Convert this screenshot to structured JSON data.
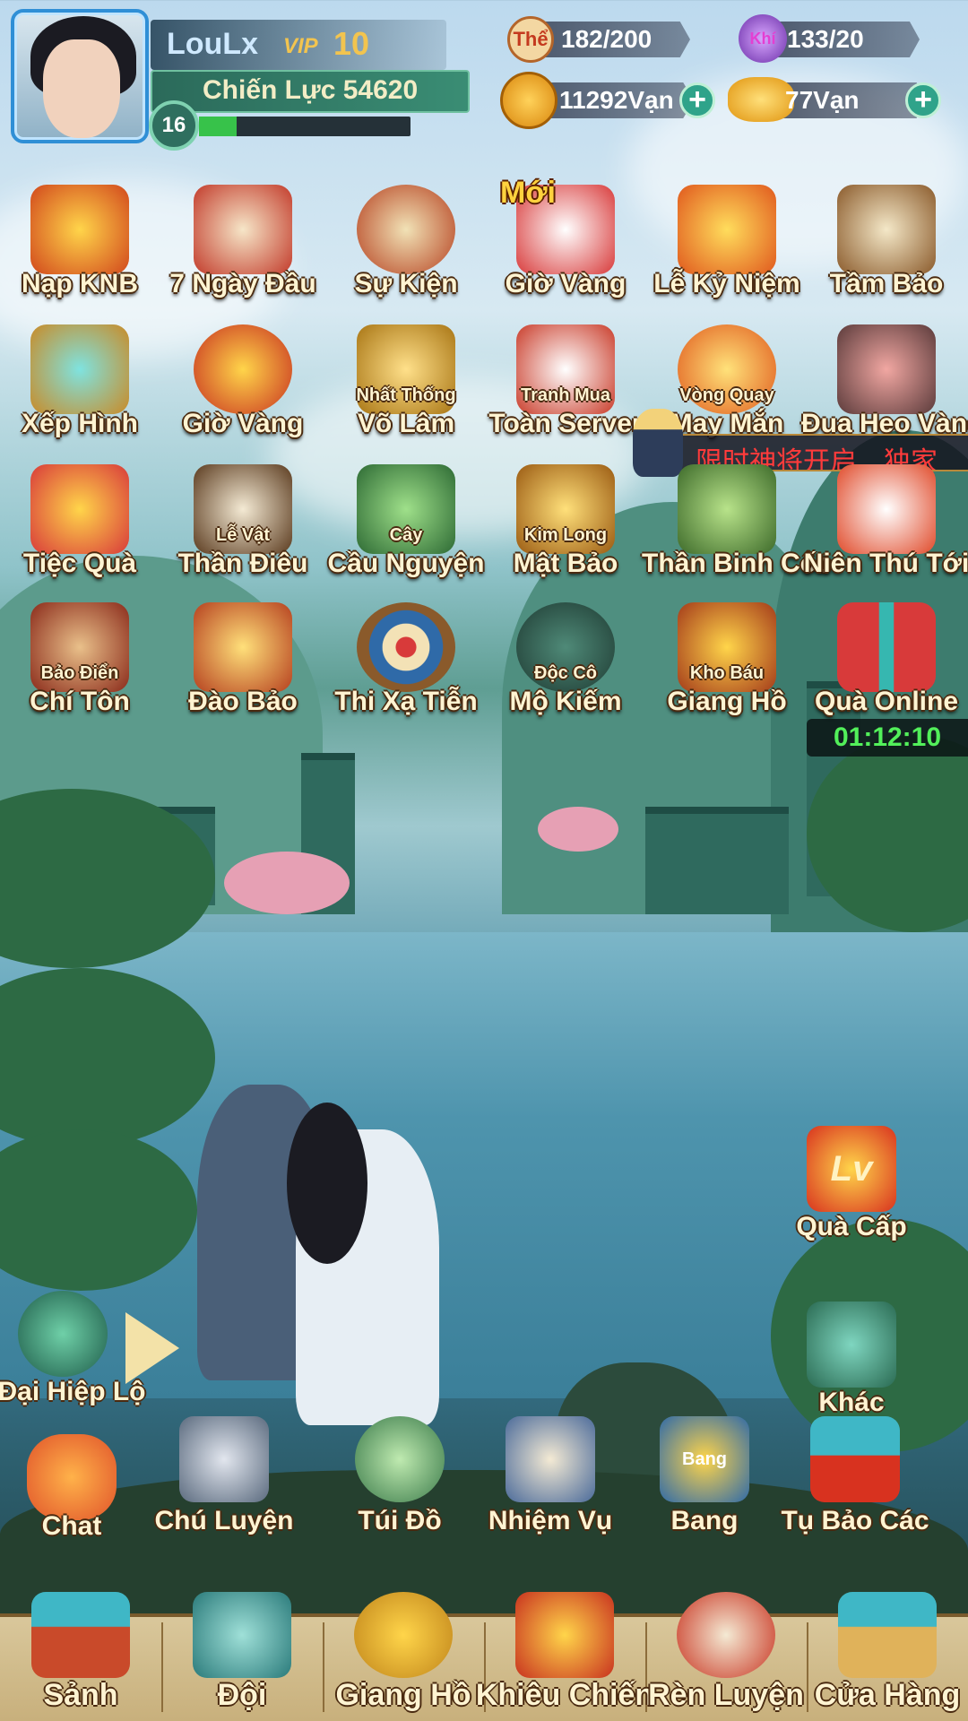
{
  "player": {
    "name": "LouLx",
    "vip_label": "VIP",
    "vip_level": "10",
    "power": "Chiến Lực 54620",
    "level": "16",
    "exp_fraction": 0.18
  },
  "resources": {
    "stamina_icon": "Thể",
    "stamina": "182/200",
    "spirit_icon": "Khí",
    "spirit": "133/20",
    "coins": "11292Vạn",
    "gold": "77Vạn"
  },
  "features": {
    "row1": [
      {
        "label": "Nạp KNB"
      },
      {
        "label": "7 Ngày Đầu"
      },
      {
        "label": "Sự Kiện"
      },
      {
        "label": "Giờ Vàng",
        "badge": "Mới"
      },
      {
        "label": "Lễ Kỷ Niệm"
      },
      {
        "label": "Tầm Bảo"
      }
    ],
    "row2": [
      {
        "label": "Xếp Hình"
      },
      {
        "label": "Giờ Vàng"
      },
      {
        "sub": "Nhất Thống",
        "label": "Võ Lâm"
      },
      {
        "sub": "Tranh Mua",
        "label": "Toàn Server"
      },
      {
        "sub": "Vòng Quay",
        "label": "May Mắn"
      },
      {
        "label": "Đua Heo Vàng"
      }
    ],
    "row3": [
      {
        "label": "Tiệc Quà"
      },
      {
        "sub": "Lễ Vật",
        "label": "Thần Điêu"
      },
      {
        "sub": "Cây",
        "label": "Cầu Nguyện"
      },
      {
        "sub": "Kim Long",
        "label": "Mật Bảo"
      },
      {
        "label": "Thần Binh Cốc"
      },
      {
        "label": "Niên Thú Tới"
      }
    ],
    "row4": [
      {
        "sub": "Bảo Điển",
        "label": "Chí Tôn"
      },
      {
        "label": "Đào Bảo"
      },
      {
        "label": "Thi Xạ Tiễn"
      },
      {
        "sub": "Độc Cô",
        "label": "Mộ Kiếm"
      },
      {
        "sub": "Kho Báu",
        "label": "Giang Hồ"
      },
      {
        "label": "Quà Online"
      }
    ]
  },
  "ticker": {
    "text": "限时神将开启，独家"
  },
  "timer": "01:12:10",
  "side": {
    "level_gift": "Quà Cấp",
    "level_gift_mark": "Lv",
    "other": "Khác",
    "hero_path": "Đại Hiệp Lộ"
  },
  "lower": [
    {
      "label": "Chat"
    },
    {
      "label": "Chú Luyện"
    },
    {
      "label": "Túi Đồ"
    },
    {
      "label": "Nhiệm Vụ"
    },
    {
      "label": "Bang",
      "sub": "Bang"
    },
    {
      "label": "Tụ Bảo Các"
    }
  ],
  "nav": [
    {
      "label": "Sảnh"
    },
    {
      "label": "Đội"
    },
    {
      "label": "Giang Hồ"
    },
    {
      "label": "Khiêu Chiến"
    },
    {
      "label": "Rèn Luyện"
    },
    {
      "label": "Cửa Hàng"
    }
  ],
  "colors": {
    "label_text": "#fff4d2",
    "label_outline": "#4a2a10",
    "ticker_text": "#ff3b3b",
    "timer_text": "#52f05a",
    "vip_gold": "#f2c44f",
    "exp_green": "#37c24a"
  }
}
